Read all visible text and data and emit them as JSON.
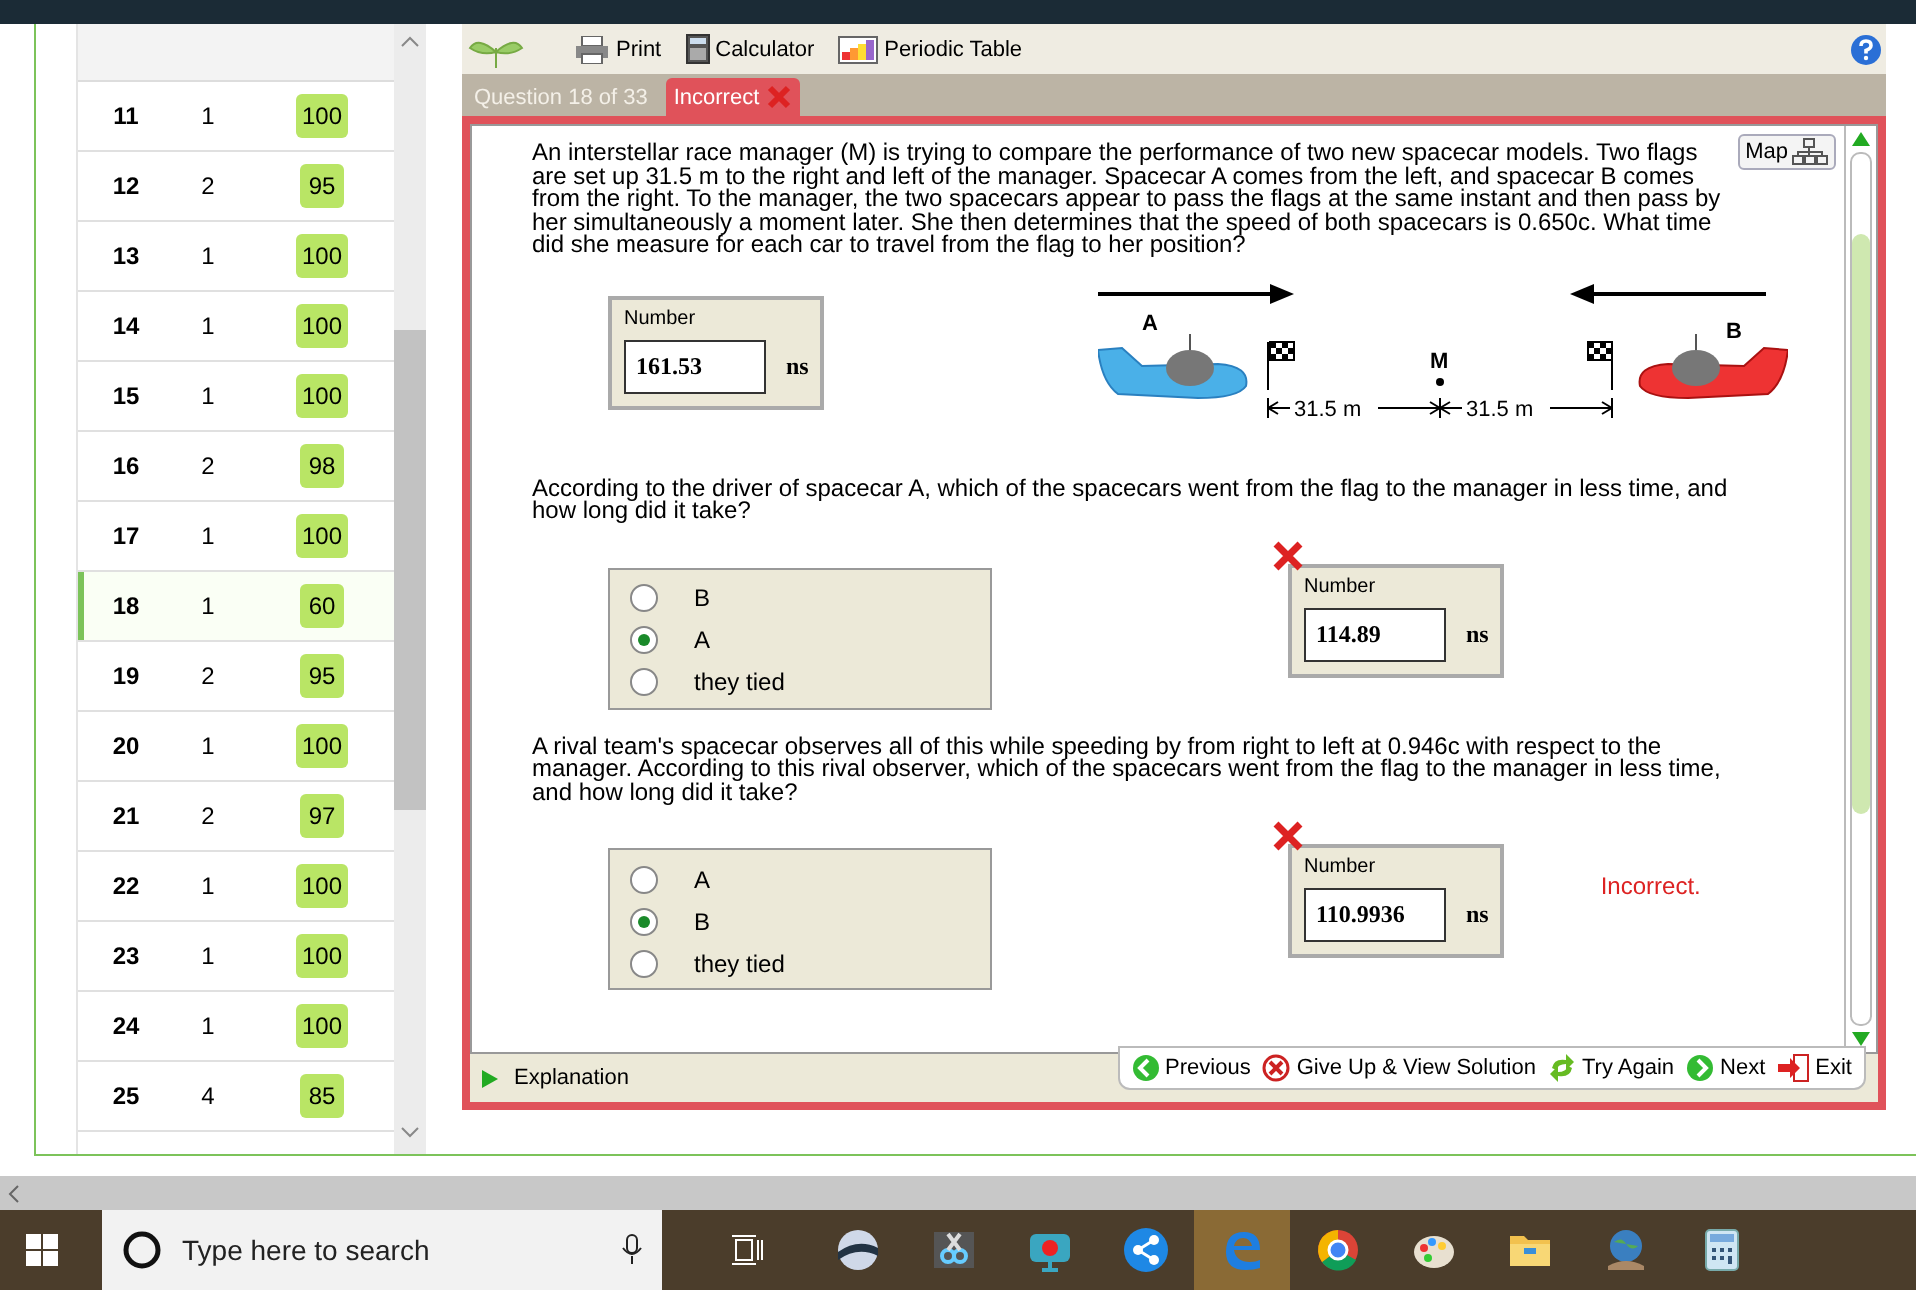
{
  "score_table": {
    "rows": [
      {
        "number": "11",
        "attempts": "1",
        "score": "100",
        "selected": false
      },
      {
        "number": "12",
        "attempts": "2",
        "score": "95",
        "selected": false
      },
      {
        "number": "13",
        "attempts": "1",
        "score": "100",
        "selected": false
      },
      {
        "number": "14",
        "attempts": "1",
        "score": "100",
        "selected": false
      },
      {
        "number": "15",
        "attempts": "1",
        "score": "100",
        "selected": false
      },
      {
        "number": "16",
        "attempts": "2",
        "score": "98",
        "selected": false
      },
      {
        "number": "17",
        "attempts": "1",
        "score": "100",
        "selected": false
      },
      {
        "number": "18",
        "attempts": "1",
        "score": "60",
        "selected": true
      },
      {
        "number": "19",
        "attempts": "2",
        "score": "95",
        "selected": false
      },
      {
        "number": "20",
        "attempts": "1",
        "score": "100",
        "selected": false
      },
      {
        "number": "21",
        "attempts": "2",
        "score": "97",
        "selected": false
      },
      {
        "number": "22",
        "attempts": "1",
        "score": "100",
        "selected": false
      },
      {
        "number": "23",
        "attempts": "1",
        "score": "100",
        "selected": false
      },
      {
        "number": "24",
        "attempts": "1",
        "score": "100",
        "selected": false
      },
      {
        "number": "25",
        "attempts": "4",
        "score": "85",
        "selected": false
      }
    ]
  },
  "toolbar": {
    "items": [
      {
        "label": "Print",
        "kind": "print"
      },
      {
        "label": "Calculator",
        "kind": "calculator"
      },
      {
        "label": "Periodic Table",
        "kind": "periodic"
      }
    ]
  },
  "tabs": [
    {
      "label": "Question 18 of 33",
      "selected": false
    },
    {
      "label": "Incorrect",
      "selected": true
    }
  ],
  "question": {
    "map_label": "Map",
    "intro": "An interstellar race manager (M) is trying to compare the performance of two new spacecar models. Two flags are set up 31.5 m to the right and left of the manager. Spacecar A comes from the left, and spacecar B comes from the right. To the manager, the two spacecars appear to pass the flags at the same instant and then pass by her simultaneously a moment later. She then determines that the speed of both spacecars is 0.650c. What time did she measure for each car to travel from the flag to her position?",
    "answer": {
      "label": "Number",
      "value": "161.53",
      "unit": "ns",
      "incorrect": false
    },
    "diagram": {
      "car_a": "A",
      "car_b": "B",
      "manager": "M",
      "left_distance": "31.5 m",
      "right_distance": "31.5 m"
    },
    "parts": [
      {
        "text": "According to the driver of spacecar A, which of the spacecars went from the flag to the manager in less time, and how long did it take?",
        "choices": [
          {
            "label": "B",
            "selected": false
          },
          {
            "label": "A",
            "selected": true
          },
          {
            "label": "they tied",
            "selected": false
          }
        ],
        "answer": {
          "label": "Number",
          "value": "114.89",
          "unit": "ns",
          "incorrect": true
        }
      },
      {
        "text": "A rival team's spacecar observes all of this while speeding by from right to left at 0.946c with respect to the manager. According to this rival observer, which of the spacecars went from the flag to the manager in less time, and how long did it take?",
        "choices": [
          {
            "label": "A",
            "selected": false
          },
          {
            "label": "B",
            "selected": true
          },
          {
            "label": "they tied",
            "selected": false
          }
        ],
        "answer": {
          "label": "Number",
          "value": "110.9936",
          "unit": "ns",
          "incorrect": true
        },
        "feedback": "Incorrect."
      }
    ]
  },
  "nav": {
    "explanation": "Explanation",
    "buttons": [
      {
        "label": "Previous",
        "kind": "previous"
      },
      {
        "label": "Give Up & View Solution",
        "kind": "giveup"
      },
      {
        "label": "Try Again",
        "kind": "retry"
      },
      {
        "label": "Next",
        "kind": "next"
      },
      {
        "label": "Exit",
        "kind": "exit"
      }
    ]
  },
  "taskbar": {
    "search_placeholder": "Type here to search",
    "apps": [
      {
        "kind": "sphere",
        "active": false
      },
      {
        "kind": "film",
        "active": false
      },
      {
        "kind": "camera",
        "active": false
      },
      {
        "kind": "share",
        "active": false
      },
      {
        "kind": "browser",
        "active": true
      },
      {
        "kind": "ring",
        "active": false
      },
      {
        "kind": "paint",
        "active": false
      },
      {
        "kind": "folder",
        "active": false
      },
      {
        "kind": "globe",
        "active": false
      },
      {
        "kind": "calculator",
        "active": false
      }
    ]
  }
}
